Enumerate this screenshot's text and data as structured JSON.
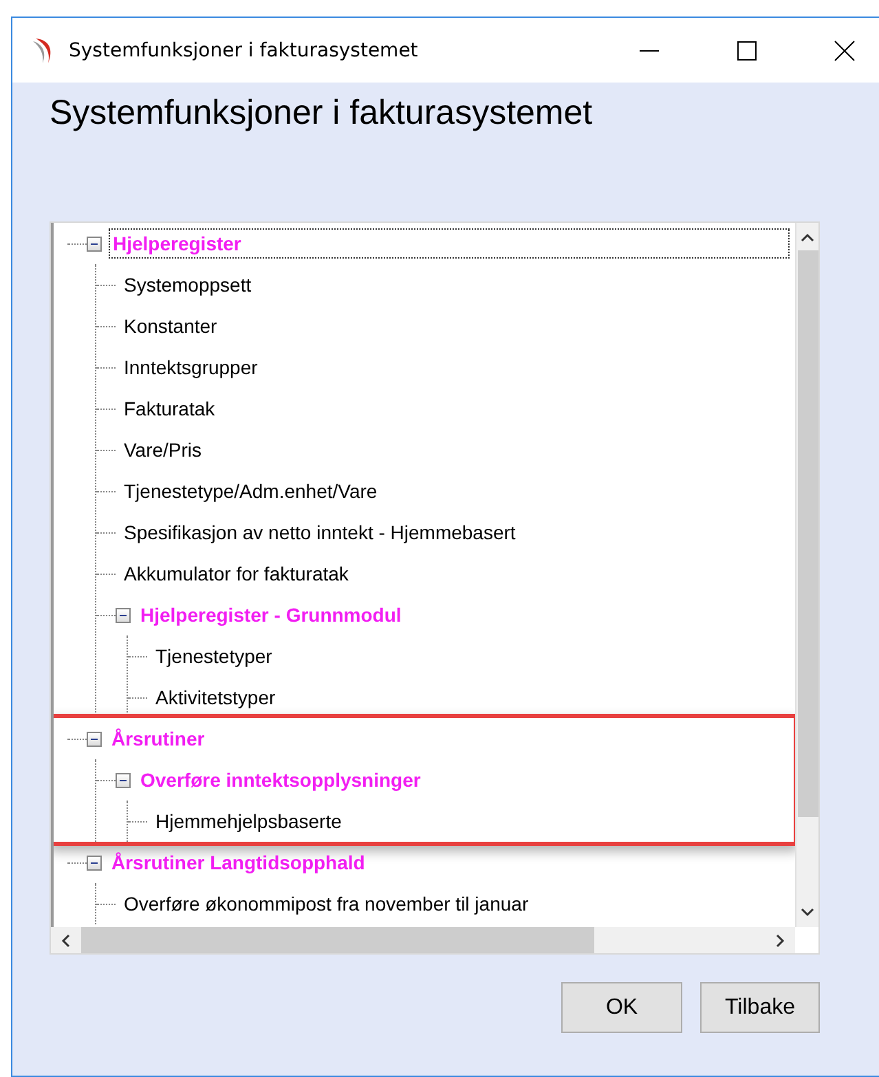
{
  "window": {
    "title": "Systemfunksjoner i fakturasystemet"
  },
  "heading": "Systemfunksjoner i fakturasystemet",
  "tree": [
    {
      "label": "Hjelperegister",
      "kind": "group",
      "expanded": true,
      "selected": true,
      "highlighted": false,
      "children": [
        {
          "label": "Systemoppsett",
          "kind": "item"
        },
        {
          "label": "Konstanter",
          "kind": "item"
        },
        {
          "label": "Inntektsgrupper",
          "kind": "item"
        },
        {
          "label": "Fakturatak",
          "kind": "item"
        },
        {
          "label": "Vare/Pris",
          "kind": "item"
        },
        {
          "label": "Tjenestetype/Adm.enhet/Vare",
          "kind": "item"
        },
        {
          "label": "Spesifikasjon av netto inntekt - Hjemmebasert",
          "kind": "item"
        },
        {
          "label": "Akkumulator for fakturatak",
          "kind": "item"
        },
        {
          "label": "Hjelperegister - Grunnmodul",
          "kind": "group",
          "expanded": true,
          "children": [
            {
              "label": "Tjenestetyper",
              "kind": "item"
            },
            {
              "label": "Aktivitetstyper",
              "kind": "item"
            }
          ]
        }
      ]
    },
    {
      "label": "Årsrutiner",
      "kind": "group",
      "expanded": true,
      "selected": false,
      "highlighted": true,
      "children": [
        {
          "label": "Overføre inntektsopplysninger",
          "kind": "group",
          "expanded": true,
          "children": [
            {
              "label": "Hjemmehjelpsbaserte",
              "kind": "item"
            }
          ]
        }
      ]
    },
    {
      "label": "Årsrutiner Langtidsopphald",
      "kind": "group",
      "expanded": true,
      "selected": false,
      "highlighted": false,
      "children": [
        {
          "label": "Overføre økonommipost fra november til januar",
          "kind": "item"
        }
      ]
    }
  ],
  "buttons": [
    "OK",
    "Tilbake"
  ]
}
